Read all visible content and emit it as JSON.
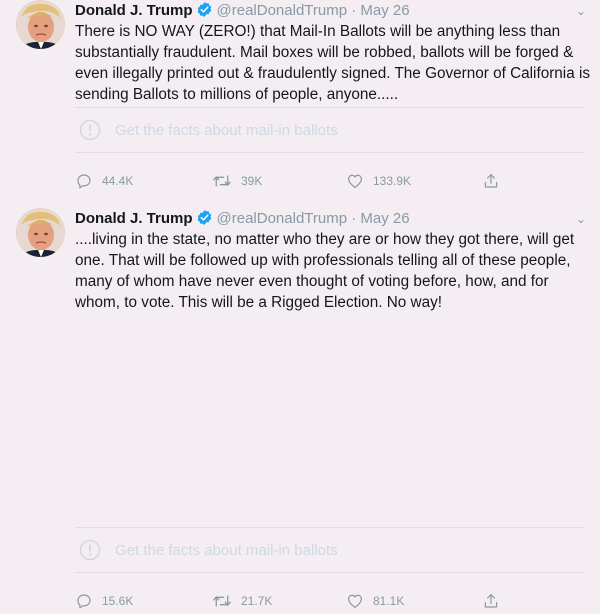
{
  "tweets": [
    {
      "author_name": "Donald J. Trump",
      "handle": "@realDonaldTrump",
      "separator": "·",
      "date": "May 26",
      "text": "There is NO WAY (ZERO!) that Mail-In Ballots will be anything less than substantially fraudulent. Mail boxes will be robbed, ballots will be forged & even illegally printed out & fraudulently signed. The Governor of California is sending Ballots to millions of people, anyone.....",
      "fact_check_label": "Get the facts about mail-in ballots",
      "reply_count": "44.4K",
      "retweet_count": "39K",
      "like_count": "133.9K"
    },
    {
      "author_name": "Donald J. Trump",
      "handle": "@realDonaldTrump",
      "separator": "·",
      "date": "May 26",
      "text": "....living in the state, no matter who they are or how they got there, will get one. That will be followed up with professionals telling all of these people, many of whom have never even thought of voting before, how, and for whom, to vote. This will be a Rigged Election. No way!",
      "fact_check_label": "Get the facts about mail-in ballots",
      "reply_count": "15.6K",
      "retweet_count": "21.7K",
      "like_count": "81.1K"
    }
  ],
  "icons": {
    "verified": "verified-badge-icon",
    "caret": "chevron-down-icon",
    "fact_check": "exclamation-circle-icon",
    "reply": "reply-icon",
    "retweet": "retweet-icon",
    "like": "heart-icon",
    "share": "share-icon"
  },
  "colors": {
    "background": "#f4eef3",
    "verified": "#1da1f2",
    "secondary_text": "#8899a6",
    "fact_check_text": "#cfd8e3"
  }
}
